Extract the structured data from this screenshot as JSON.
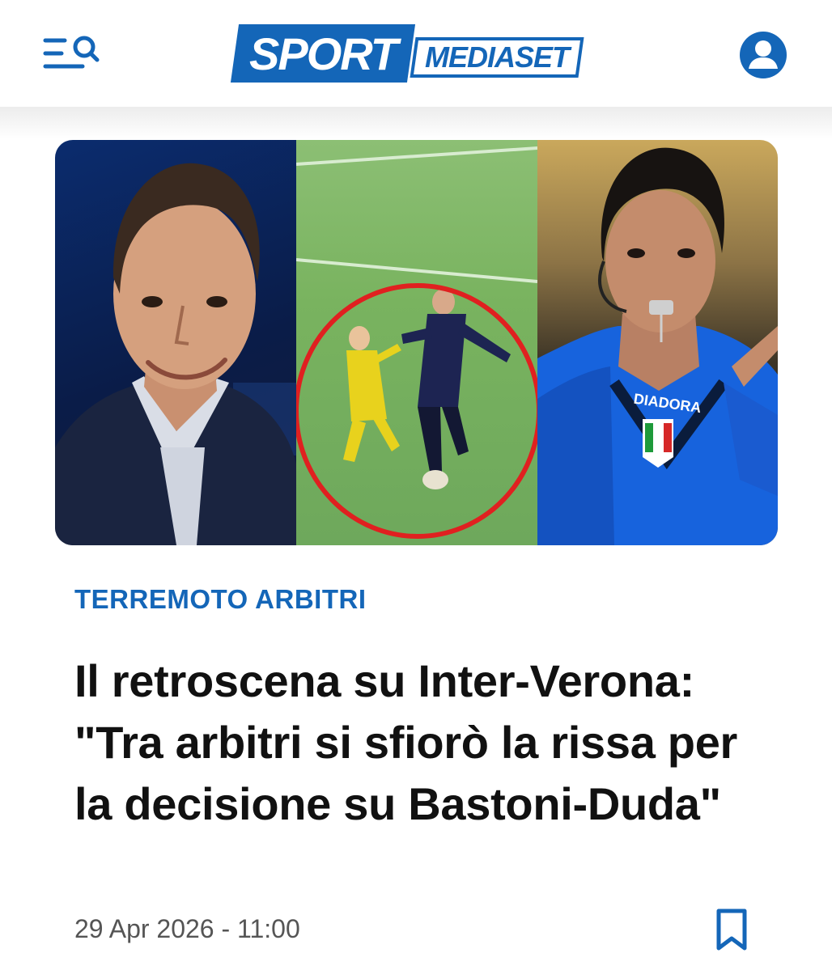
{
  "header": {
    "menu_icon": "menu-search-icon",
    "logo": {
      "primary": "SPORT",
      "secondary": "MEDIASET"
    },
    "account_icon": "user-account-icon"
  },
  "colors": {
    "brand": "#1466b8",
    "title_text": "#111111",
    "date_text": "#555555",
    "highlight_circle": "#e02020"
  },
  "article": {
    "category": "TERREMOTO ARBITRI",
    "title": "Il retroscena su Inter-Verona: \"Tra arbitri si sfiorò la rissa per la decisione su Bastoni-Duda\"",
    "date": "29 Apr 2026 - 11:00",
    "bookmark_icon": "bookmark-icon",
    "image": {
      "panels": [
        "pundit-portrait",
        "match-incident",
        "referee-portrait"
      ],
      "jersey_text": "DIADORA"
    }
  }
}
